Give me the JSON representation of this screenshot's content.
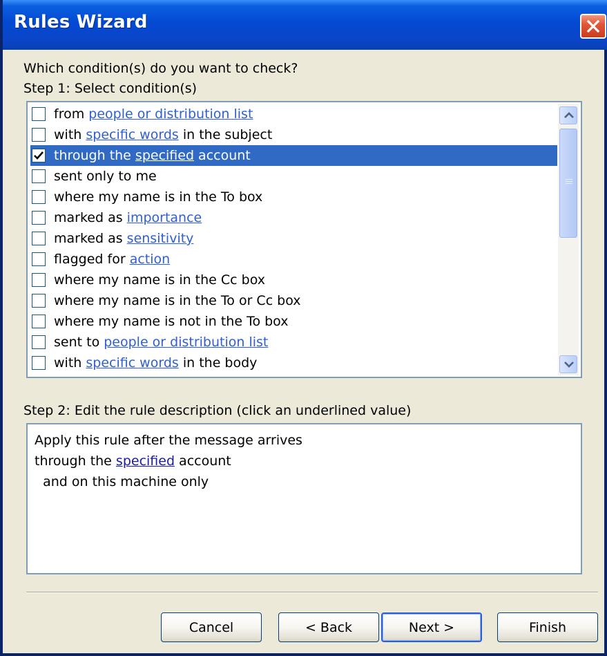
{
  "window": {
    "title": "Rules Wizard"
  },
  "step1": {
    "question": "Which condition(s) do you want to check?",
    "heading": "Step 1: Select condition(s)"
  },
  "conditions": [
    {
      "checked": false,
      "selected": false,
      "parts": [
        {
          "t": "from "
        },
        {
          "t": "people or distribution list",
          "link": true
        }
      ]
    },
    {
      "checked": false,
      "selected": false,
      "parts": [
        {
          "t": "with "
        },
        {
          "t": "specific words",
          "link": true
        },
        {
          "t": " in the subject"
        }
      ]
    },
    {
      "checked": true,
      "selected": true,
      "parts": [
        {
          "t": "through the "
        },
        {
          "t": "specified",
          "link": true
        },
        {
          "t": " account"
        }
      ]
    },
    {
      "checked": false,
      "selected": false,
      "parts": [
        {
          "t": "sent only to me"
        }
      ]
    },
    {
      "checked": false,
      "selected": false,
      "parts": [
        {
          "t": "where my name is in the To box"
        }
      ]
    },
    {
      "checked": false,
      "selected": false,
      "parts": [
        {
          "t": "marked as "
        },
        {
          "t": "importance",
          "link": true
        }
      ]
    },
    {
      "checked": false,
      "selected": false,
      "parts": [
        {
          "t": "marked as "
        },
        {
          "t": "sensitivity",
          "link": true
        }
      ]
    },
    {
      "checked": false,
      "selected": false,
      "parts": [
        {
          "t": "flagged for "
        },
        {
          "t": "action",
          "link": true
        }
      ]
    },
    {
      "checked": false,
      "selected": false,
      "parts": [
        {
          "t": "where my name is in the Cc box"
        }
      ]
    },
    {
      "checked": false,
      "selected": false,
      "parts": [
        {
          "t": "where my name is in the To or Cc box"
        }
      ]
    },
    {
      "checked": false,
      "selected": false,
      "parts": [
        {
          "t": "where my name is not in the To box"
        }
      ]
    },
    {
      "checked": false,
      "selected": false,
      "parts": [
        {
          "t": "sent to "
        },
        {
          "t": "people or distribution list",
          "link": true
        }
      ]
    },
    {
      "checked": false,
      "selected": false,
      "parts": [
        {
          "t": "with "
        },
        {
          "t": "specific words",
          "link": true
        },
        {
          "t": " in the body"
        }
      ]
    }
  ],
  "step2": {
    "heading": "Step 2: Edit the rule description (click an underlined value)",
    "lines": [
      {
        "parts": [
          {
            "t": "Apply this rule after the message arrives"
          }
        ]
      },
      {
        "parts": [
          {
            "t": "through the "
          },
          {
            "t": "specified",
            "link": true
          },
          {
            "t": " account"
          }
        ]
      },
      {
        "parts": [
          {
            "t": "  and on this machine only"
          }
        ]
      }
    ]
  },
  "buttons": {
    "cancel": "Cancel",
    "back": "< Back",
    "next": "Next >",
    "finish": "Finish"
  },
  "colors": {
    "titlebar": "#0449d3",
    "selection": "#316ac5",
    "link": "#2f5fd0",
    "dialog_bg": "#ece9d8"
  }
}
